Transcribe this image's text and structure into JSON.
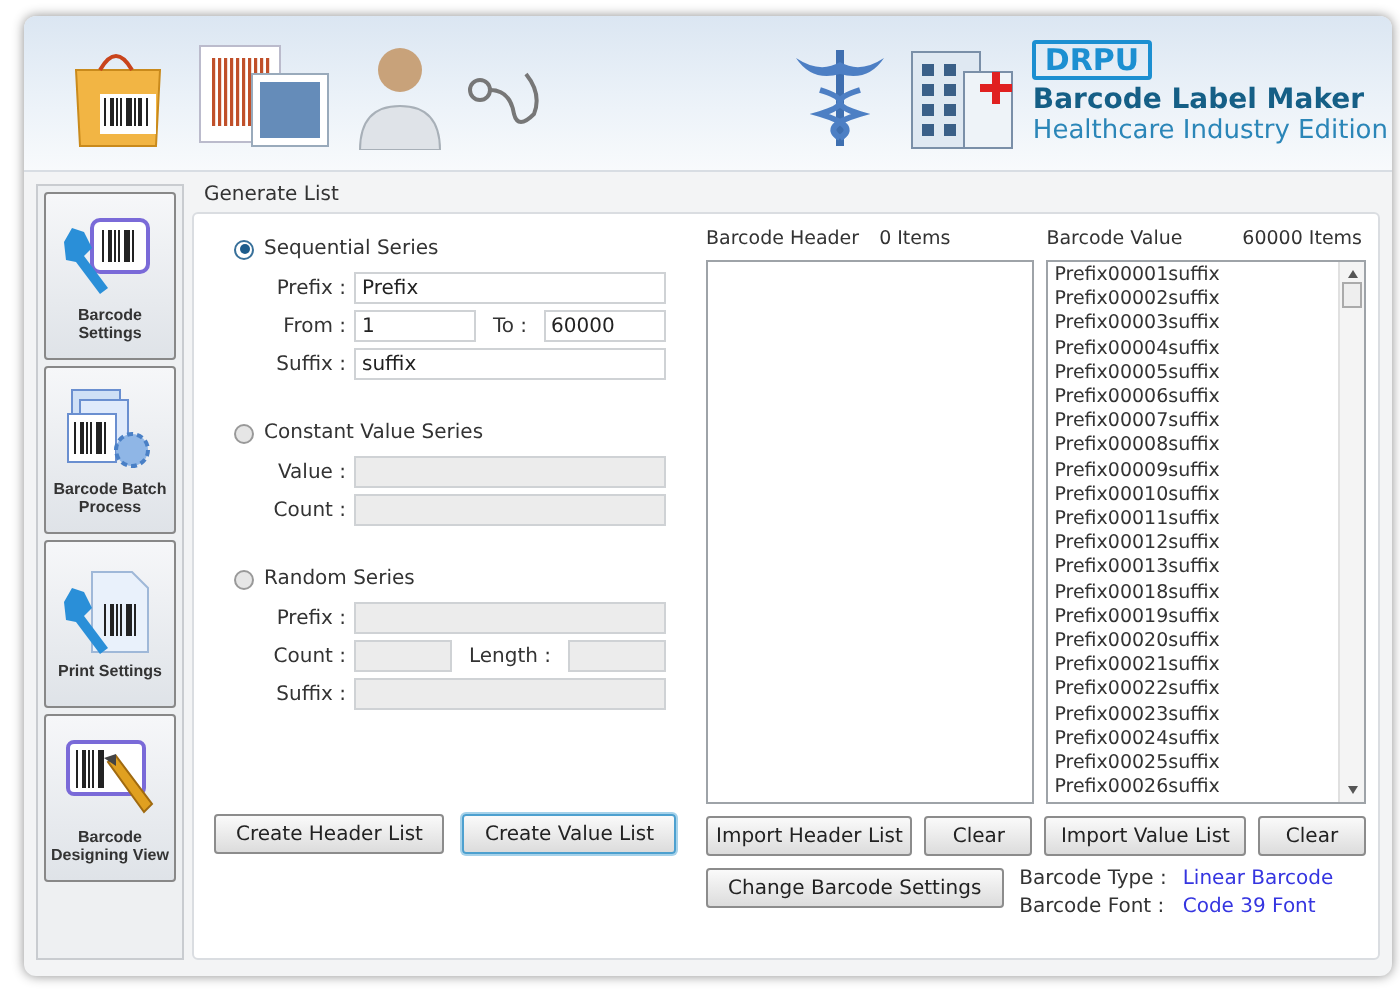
{
  "header": {
    "brand": "DRPU",
    "title": "Barcode Label Maker",
    "subtitle": "Healthcare Industry Edition"
  },
  "sidebar": {
    "items": [
      {
        "kind": "settings",
        "label": "Barcode Settings"
      },
      {
        "kind": "batch",
        "label": "Barcode Batch Process"
      },
      {
        "kind": "print",
        "label": "Print Settings"
      },
      {
        "kind": "design",
        "label": "Barcode Designing View"
      }
    ]
  },
  "generate_list": {
    "title": "Generate List",
    "series": [
      {
        "label": "Sequential Series",
        "selected": true,
        "rows": [
          [
            {
              "label": "Prefix :",
              "value": "Prefix",
              "disabled": false
            }
          ],
          [
            {
              "label": "From :",
              "value": "1",
              "disabled": false
            },
            {
              "label": "To :",
              "value": "60000",
              "disabled": false
            }
          ],
          [
            {
              "label": "Suffix :",
              "value": "suffix",
              "disabled": false
            }
          ]
        ]
      },
      {
        "label": "Constant Value Series",
        "selected": false,
        "rows": [
          [
            {
              "label": "Value :",
              "disabled": true
            }
          ],
          [
            {
              "label": "Count :",
              "disabled": true
            }
          ]
        ]
      },
      {
        "label": "Random Series",
        "selected": false,
        "rows": [
          [
            {
              "label": "Prefix :",
              "disabled": true
            }
          ],
          [
            {
              "label": "Count :",
              "disabled": true
            },
            {
              "label": "Length :",
              "disabled": true
            }
          ],
          [
            {
              "label": "Suffix :",
              "disabled": true
            }
          ]
        ]
      }
    ],
    "buttons": [
      {
        "label": "Create Header List",
        "focused": false
      },
      {
        "label": "Create Value List",
        "focused": true
      }
    ],
    "header_list": {
      "title": "Barcode Header",
      "count": "0 Items"
    },
    "value_list": {
      "title": "Barcode Value",
      "count": "60000 Items",
      "items": [
        "Prefix00001suffix",
        "Prefix00002suffix",
        "Prefix00003suffix",
        "Prefix00004suffix",
        "Prefix00005suffix",
        "Prefix00006suffix",
        "Prefix00007suffix",
        "Prefix00008suffix",
        "Prefix00009suffix",
        "Prefix00010suffix",
        "Prefix00011suffix",
        "Prefix00012suffix",
        "Prefix00013suffix",
        "Prefix00018suffix",
        "Prefix00019suffix",
        "Prefix00020suffix",
        "Prefix00021suffix",
        "Prefix00022suffix",
        "Prefix00023suffix",
        "Prefix00024suffix",
        "Prefix00025suffix",
        "Prefix00026suffix"
      ]
    },
    "list_buttons": [
      "Import Header List",
      "Clear",
      "Import Value List",
      "Clear"
    ],
    "settings_button": "Change Barcode Settings",
    "info": [
      {
        "label": "Barcode Type :",
        "value": "Linear Barcode"
      },
      {
        "label": "Barcode Font :",
        "value": "Code 39 Font"
      }
    ]
  }
}
